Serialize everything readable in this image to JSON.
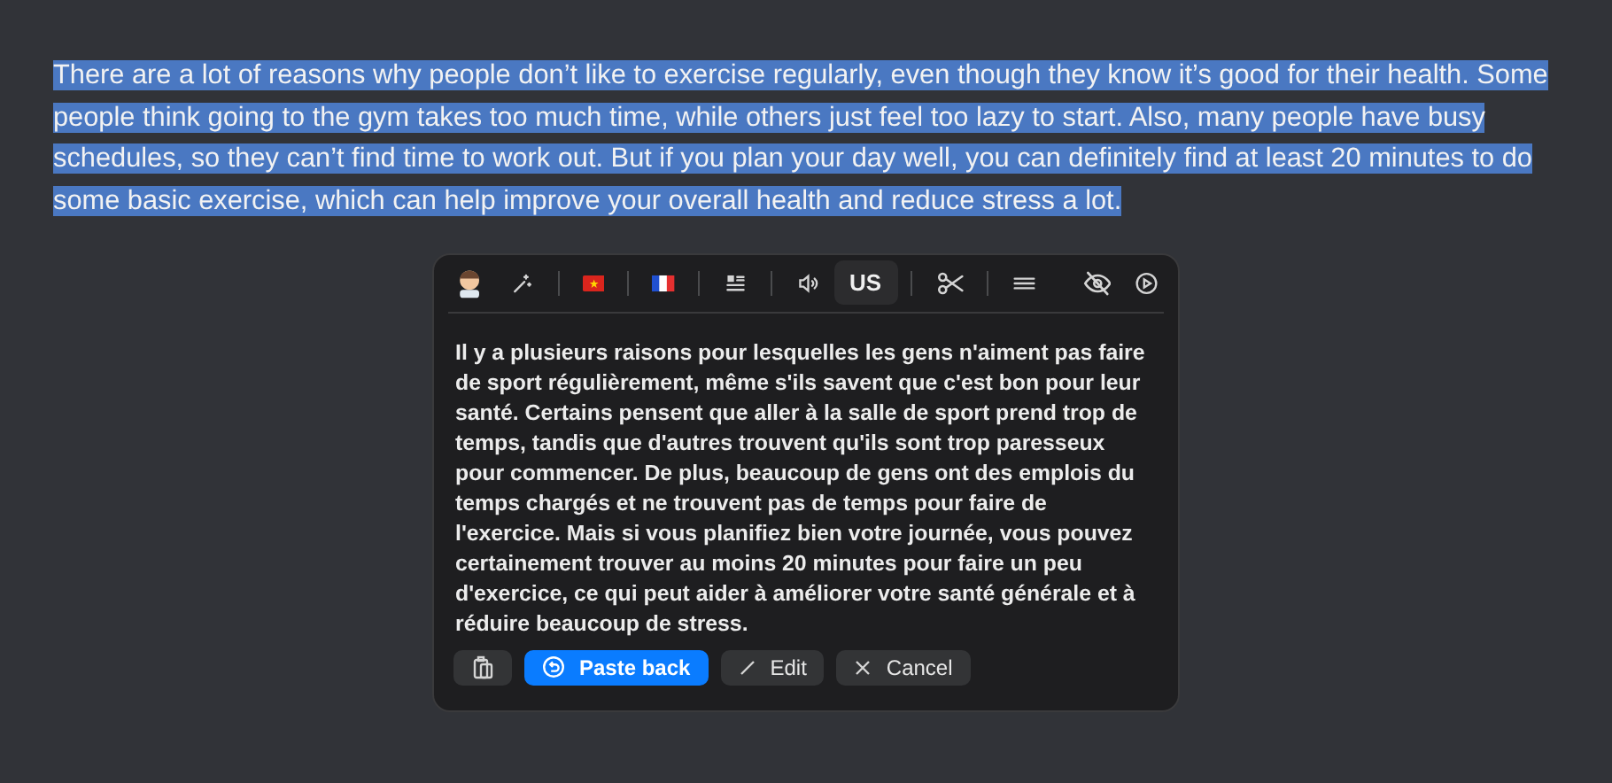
{
  "selected_text": {
    "text": "There are a lot of reasons why people don’t like to exercise regularly, even though they know it’s good for their health. Some people think going to the gym takes too much time, while others just feel too lazy to start. Also, many people have busy schedules, so they can’t find time to work out. But if you plan your day well, you can definitely find at least 20 minutes to do some basic exercise, which can help improve your overall health and reduce stress a lot.",
    "selected": true
  },
  "popup": {
    "toolbar": {
      "voice": {
        "label": "US",
        "selected": true
      }
    },
    "translation": "Il y a plusieurs raisons pour lesquelles les gens n'aiment pas faire de sport régulièrement, même s'ils savent que c'est bon pour leur santé. Certains pensent que aller à la salle de sport prend trop de temps, tandis que d'autres trouvent qu'ils sont trop paresseux pour commencer. De plus, beaucoup de gens ont des emplois du temps chargés et ne trouvent pas de temps pour faire de l'exercice. Mais si vous planifiez bien votre journée, vous pouvez certainement trouver au moins 20 minutes pour faire un peu d'exercice, ce qui peut aider à améliorer votre santé générale et à réduire beaucoup de stress.",
    "buttons": [
      {
        "kind": "copy"
      },
      {
        "kind": "primary",
        "label": "Paste back"
      },
      {
        "kind": "edit",
        "label": "Edit"
      },
      {
        "kind": "cancel",
        "label": "Cancel"
      }
    ]
  }
}
